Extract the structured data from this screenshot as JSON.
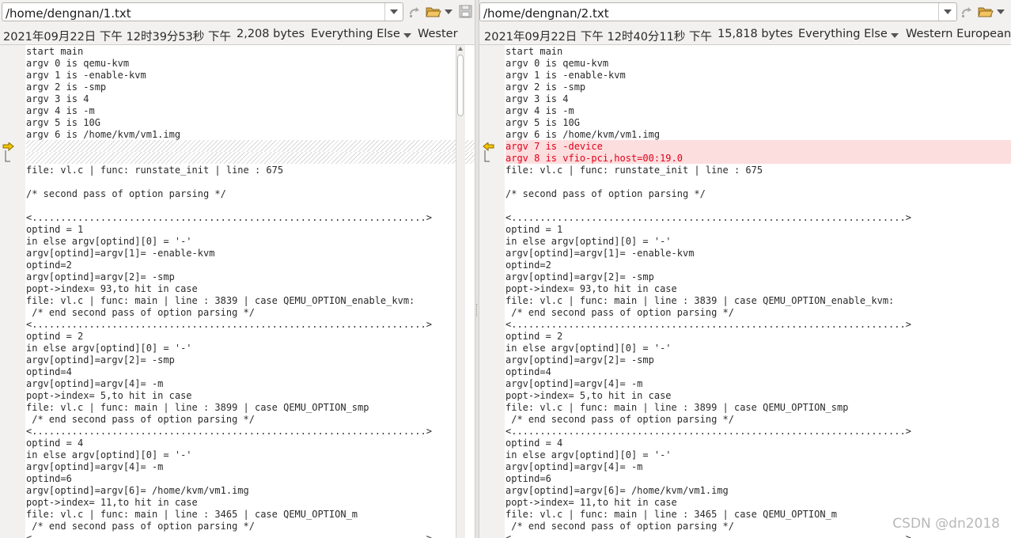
{
  "left": {
    "path": "/home/dengnan/1.txt",
    "date": "2021年09月22日 下午 12时39分53秒 下午",
    "size": "2,208 bytes",
    "syntax": "Everything Else",
    "encoding": "Wester"
  },
  "right": {
    "path": "/home/dengnan/2.txt",
    "date": "2021年09月22日 下午 12时40分11秒 下午",
    "size": "15,818 bytes",
    "syntax": "Everything Else",
    "encoding": "Western European"
  },
  "lines_head": [
    "start main",
    "argv 0 is qemu-kvm",
    "argv 1 is -enable-kvm",
    "argv 2 is -smp",
    "argv 3 is 4",
    "argv 4 is -m",
    "argv 5 is 10G",
    "argv 6 is /home/kvm/vm1.img"
  ],
  "right_inserted": [
    "argv 7 is -device",
    "argv 8 is vfio-pci,host=00:19.0"
  ],
  "lines_tail": [
    "file: vl.c | func: runstate_init | line : 675",
    "",
    "/* second pass of option parsing */",
    "",
    "<.....................................................................>",
    "optind = 1",
    "in else argv[optind][0] = '-'",
    "argv[optind]=argv[1]= -enable-kvm",
    "optind=2",
    "argv[optind]=argv[2]= -smp",
    "popt->index= 93,to hit in case",
    "file: vl.c | func: main | line : 3839 | case QEMU_OPTION_enable_kvm:",
    " /* end second pass of option parsing */",
    "<.....................................................................>",
    "optind = 2",
    "in else argv[optind][0] = '-'",
    "argv[optind]=argv[2]= -smp",
    "optind=4",
    "argv[optind]=argv[4]= -m",
    "popt->index= 5,to hit in case",
    "file: vl.c | func: main | line : 3899 | case QEMU_OPTION_smp",
    " /* end second pass of option parsing */",
    "<.....................................................................>",
    "optind = 4",
    "in else argv[optind][0] = '-'",
    "argv[optind]=argv[4]= -m",
    "optind=6",
    "argv[optind]=argv[6]= /home/kvm/vm1.img",
    "popt->index= 11,to hit in case",
    "file: vl.c | func: main | line : 3465 | case QEMU_OPTION_m",
    " /* end second pass of option parsing */",
    "<.....................................................................>"
  ],
  "watermark": "CSDN @dn2018",
  "colors": {
    "changed_bg": "#fddede",
    "changed_fg": "#e1001a",
    "marker": "#f5c400"
  },
  "icons": [
    "redo-icon",
    "folder-open-icon",
    "save-icon",
    "dropdown-icon",
    "change-marker-arrow-icon"
  ]
}
